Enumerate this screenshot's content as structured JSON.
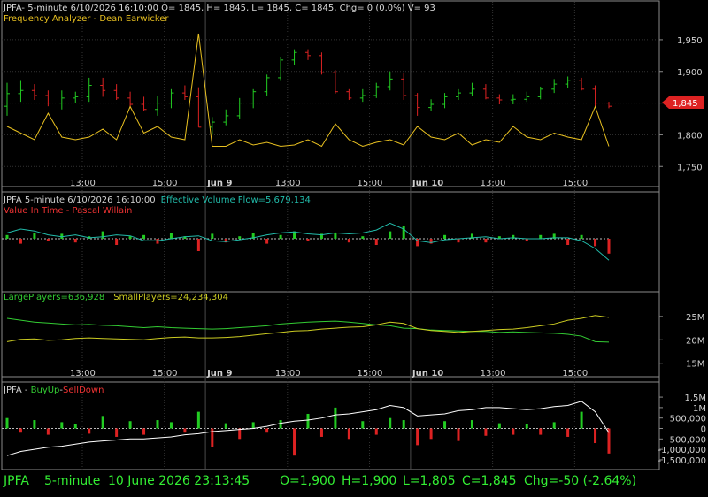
{
  "colors": {
    "background": "#000000",
    "border": "#8a8a8a",
    "grid": "#333333",
    "text": "#d0d0d0",
    "up": "#22cc22",
    "down": "#dd2222",
    "frequency": "#e8c020",
    "efv": "#22bbaa",
    "value_in_time_label": "#ee3333",
    "large_players": "#33cc33",
    "small_players": "#cccc22",
    "buyup_line": "#ffffff",
    "status_text": "#33ee33",
    "price_tag": "#dd2222"
  },
  "header": {
    "symbol_line": "JPFA- 5-minute 6/10/2026 16:10:00 O= 1845, H= 1845, L= 1845, C= 1845, Chg= 0 (0.0%) V= 93",
    "indicator_label": "Frequency Analyzer - Dean Earwicker"
  },
  "efv_panel": {
    "title_prefix": "JPFA 5-minute  6/10/2026 16:10:00",
    "title_efv": "Effective Volume Flow=5,679,134",
    "subtitle": "Value In Time - Pascal Willain"
  },
  "players_panel": {
    "large_label": "LargePlayers=636,928",
    "small_label": "SmallPlayers=24,234,304"
  },
  "buyup_panel": {
    "prefix": "JPFA - ",
    "buy_label": "BuyUp",
    "separator": "-",
    "sell_label": "SellDown"
  },
  "price_tag": "1,845",
  "time_axis": [
    "13:00",
    "15:00",
    "Jun 9",
    "13:00",
    "15:00",
    "Jun 10",
    "13:00",
    "15:00"
  ],
  "status_bar": {
    "symbol": "JPFA",
    "interval": "5-minute",
    "datetime": "10 June 2026 23:13:45",
    "open": "O=1,900",
    "high": "H=1,900",
    "low": "L=1,805",
    "close": "C=1,845",
    "change": "Chg=-50 (-2.64%)"
  },
  "chart_data": [
    {
      "type": "candlestick",
      "name": "JPFA 5-minute price",
      "ylim": [
        1735,
        1975
      ],
      "yticks": [
        1750,
        1800,
        1850,
        1900,
        1950
      ],
      "ytick_labels": [
        "1,750",
        "1,800",
        "",
        "1,900",
        "1,950"
      ],
      "x": [
        "6/8 09:00",
        "6/8 09:30",
        "6/8 10:00",
        "6/8 10:30",
        "6/8 11:00",
        "6/8 11:30",
        "6/8 12:00",
        "6/8 12:30",
        "6/8 13:00",
        "6/8 13:30",
        "6/8 14:00",
        "6/8 14:30",
        "6/8 15:00",
        "6/8 15:30",
        "6/8 16:00",
        "6/9 09:00",
        "6/9 09:30",
        "6/9 10:00",
        "6/9 10:30",
        "6/9 11:00",
        "6/9 11:30",
        "6/9 12:00",
        "6/9 12:30",
        "6/9 13:00",
        "6/9 13:30",
        "6/9 14:00",
        "6/9 14:30",
        "6/9 15:00",
        "6/9 15:30",
        "6/9 16:00",
        "6/10 09:00",
        "6/10 09:30",
        "6/10 10:00",
        "6/10 10:30",
        "6/10 11:00",
        "6/10 11:30",
        "6/10 12:00",
        "6/10 12:30",
        "6/10 13:00",
        "6/10 13:30",
        "6/10 14:00",
        "6/10 14:30",
        "6/10 15:00",
        "6/10 15:30",
        "6/10 16:00"
      ],
      "open": [
        1845,
        1865,
        1870,
        1862,
        1850,
        1858,
        1860,
        1878,
        1870,
        1858,
        1848,
        1840,
        1850,
        1866,
        1860,
        1812,
        1820,
        1830,
        1850,
        1868,
        1890,
        1918,
        1930,
        1925,
        1898,
        1868,
        1858,
        1862,
        1876,
        1888,
        1862,
        1843,
        1848,
        1860,
        1866,
        1872,
        1858,
        1855,
        1856,
        1860,
        1872,
        1880,
        1886,
        1872,
        1850
      ],
      "high": [
        1882,
        1885,
        1880,
        1870,
        1870,
        1868,
        1890,
        1890,
        1880,
        1868,
        1860,
        1862,
        1872,
        1878,
        1875,
        1828,
        1840,
        1858,
        1872,
        1895,
        1922,
        1935,
        1935,
        1930,
        1902,
        1872,
        1872,
        1882,
        1900,
        1898,
        1866,
        1856,
        1866,
        1872,
        1882,
        1880,
        1864,
        1864,
        1868,
        1876,
        1888,
        1892,
        1890,
        1878,
        1852
      ],
      "low": [
        1830,
        1852,
        1855,
        1845,
        1840,
        1850,
        1852,
        1860,
        1855,
        1842,
        1838,
        1830,
        1842,
        1855,
        1812,
        1800,
        1815,
        1825,
        1842,
        1862,
        1885,
        1910,
        1918,
        1895,
        1865,
        1855,
        1852,
        1858,
        1870,
        1855,
        1830,
        1838,
        1842,
        1855,
        1862,
        1856,
        1848,
        1848,
        1852,
        1856,
        1866,
        1874,
        1870,
        1845,
        1842
      ],
      "close": [
        1865,
        1870,
        1862,
        1850,
        1858,
        1860,
        1878,
        1870,
        1858,
        1848,
        1840,
        1850,
        1866,
        1860,
        1812,
        1820,
        1830,
        1850,
        1868,
        1890,
        1918,
        1930,
        1925,
        1898,
        1868,
        1858,
        1862,
        1876,
        1888,
        1862,
        1843,
        1848,
        1860,
        1866,
        1872,
        1858,
        1855,
        1856,
        1860,
        1872,
        1880,
        1886,
        1872,
        1850,
        1845
      ]
    },
    {
      "type": "line",
      "name": "Frequency Analyzer",
      "values": [
        0.2,
        0.15,
        0.1,
        0.3,
        0.12,
        0.1,
        0.12,
        0.18,
        0.1,
        0.35,
        0.15,
        0.2,
        0.12,
        0.1,
        0.9,
        0.05,
        0.05,
        0.1,
        0.06,
        0.08,
        0.05,
        0.06,
        0.1,
        0.05,
        0.22,
        0.1,
        0.05,
        0.08,
        0.1,
        0.06,
        0.2,
        0.12,
        0.1,
        0.15,
        0.06,
        0.1,
        0.08,
        0.2,
        0.12,
        0.1,
        0.15,
        0.12,
        0.1,
        0.35,
        0.05
      ]
    },
    {
      "type": "bar+line",
      "name": "Effective Volume Flow",
      "bar_values": [
        0.3,
        -0.4,
        0.5,
        -0.2,
        0.4,
        -0.3,
        0.2,
        0.6,
        -0.5,
        0.2,
        0.3,
        -0.4,
        0.5,
        0.2,
        -1.0,
        0.4,
        -0.3,
        0.2,
        0.5,
        -0.4,
        0.3,
        0.6,
        -0.2,
        0.4,
        0.5,
        -0.3,
        0.2,
        -0.5,
        0.6,
        1.0,
        -0.6,
        -0.4,
        0.3,
        -0.3,
        0.4,
        -0.3,
        0.2,
        0.3,
        -0.2,
        0.3,
        0.4,
        -0.5,
        0.3,
        -0.6,
        -1.2
      ],
      "flow_line": [
        0.3,
        0.5,
        0.4,
        0.2,
        0.1,
        0.2,
        0.05,
        0.1,
        0.2,
        0.15,
        -0.1,
        -0.1,
        0.0,
        0.1,
        0.15,
        -0.1,
        -0.15,
        -0.05,
        0.05,
        0.2,
        0.3,
        0.35,
        0.25,
        0.2,
        0.3,
        0.25,
        0.3,
        0.45,
        0.8,
        0.5,
        -0.1,
        -0.2,
        -0.05,
        0.0,
        0.05,
        0.1,
        0.0,
        0.05,
        0.0,
        0.0,
        0.05,
        0.05,
        -0.1,
        -0.5,
        -1.1
      ]
    },
    {
      "type": "line",
      "name": "Large / Small Players",
      "ylim": [
        14000000,
        28000000
      ],
      "yticks": [
        15000000,
        20000000,
        25000000
      ],
      "ytick_labels": [
        "15M",
        "20M",
        "25M"
      ],
      "series": [
        {
          "name": "LargePlayers",
          "values": [
            24.6,
            24.2,
            23.8,
            23.6,
            23.4,
            23.2,
            23.3,
            23.1,
            23.0,
            22.8,
            22.6,
            22.8,
            22.6,
            22.5,
            22.4,
            22.3,
            22.4,
            22.6,
            22.8,
            23.0,
            23.4,
            23.6,
            23.8,
            23.9,
            24.0,
            23.8,
            23.5,
            23.2,
            23.0,
            22.5,
            22.4,
            22.1,
            22.0,
            21.9,
            21.8,
            21.8,
            21.6,
            21.7,
            21.6,
            21.5,
            21.4,
            21.2,
            20.8,
            19.6,
            19.5
          ]
        },
        {
          "name": "SmallPlayers",
          "values": [
            19.6,
            20.1,
            20.2,
            19.9,
            20.0,
            20.3,
            20.4,
            20.3,
            20.2,
            20.1,
            20.0,
            20.3,
            20.5,
            20.6,
            20.4,
            20.4,
            20.5,
            20.7,
            21.0,
            21.3,
            21.6,
            21.9,
            22.0,
            22.3,
            22.5,
            22.7,
            22.8,
            23.2,
            23.8,
            23.5,
            22.4,
            22.0,
            21.8,
            21.6,
            21.8,
            22.0,
            22.2,
            22.3,
            22.6,
            23.0,
            23.4,
            24.2,
            24.6,
            25.2,
            24.8
          ]
        }
      ]
    },
    {
      "type": "bar+line",
      "name": "BuyUp-SellDown",
      "ylim": [
        -1800000,
        1800000
      ],
      "yticks": [
        1500000,
        1000000,
        500000,
        0,
        -500000,
        -1000000,
        -1500000
      ],
      "ytick_labels": [
        "1.5M",
        "1M",
        "500,000",
        "0",
        "-500,000",
        "-1,000,000",
        "-1,500,000"
      ],
      "bar_values": [
        500000,
        -200000,
        400000,
        -300000,
        300000,
        200000,
        -250000,
        600000,
        -400000,
        350000,
        -300000,
        400000,
        300000,
        -200000,
        800000,
        -900000,
        250000,
        -500000,
        300000,
        -200000,
        400000,
        -1300000,
        700000,
        -400000,
        1000000,
        -500000,
        350000,
        -300000,
        500000,
        400000,
        -800000,
        -500000,
        350000,
        -600000,
        400000,
        -350000,
        250000,
        -300000,
        200000,
        -300000,
        300000,
        -400000,
        800000,
        -700000,
        -1200000
      ],
      "cum_line": [
        -1300000,
        -1100000,
        -1000000,
        -900000,
        -850000,
        -750000,
        -650000,
        -600000,
        -550000,
        -500000,
        -500000,
        -450000,
        -400000,
        -300000,
        -250000,
        -150000,
        -100000,
        -50000,
        0,
        100000,
        250000,
        350000,
        400000,
        500000,
        650000,
        700000,
        800000,
        900000,
        1100000,
        1000000,
        600000,
        650000,
        700000,
        850000,
        900000,
        1000000,
        1000000,
        950000,
        900000,
        950000,
        1050000,
        1100000,
        1300000,
        800000,
        -200000
      ]
    }
  ]
}
